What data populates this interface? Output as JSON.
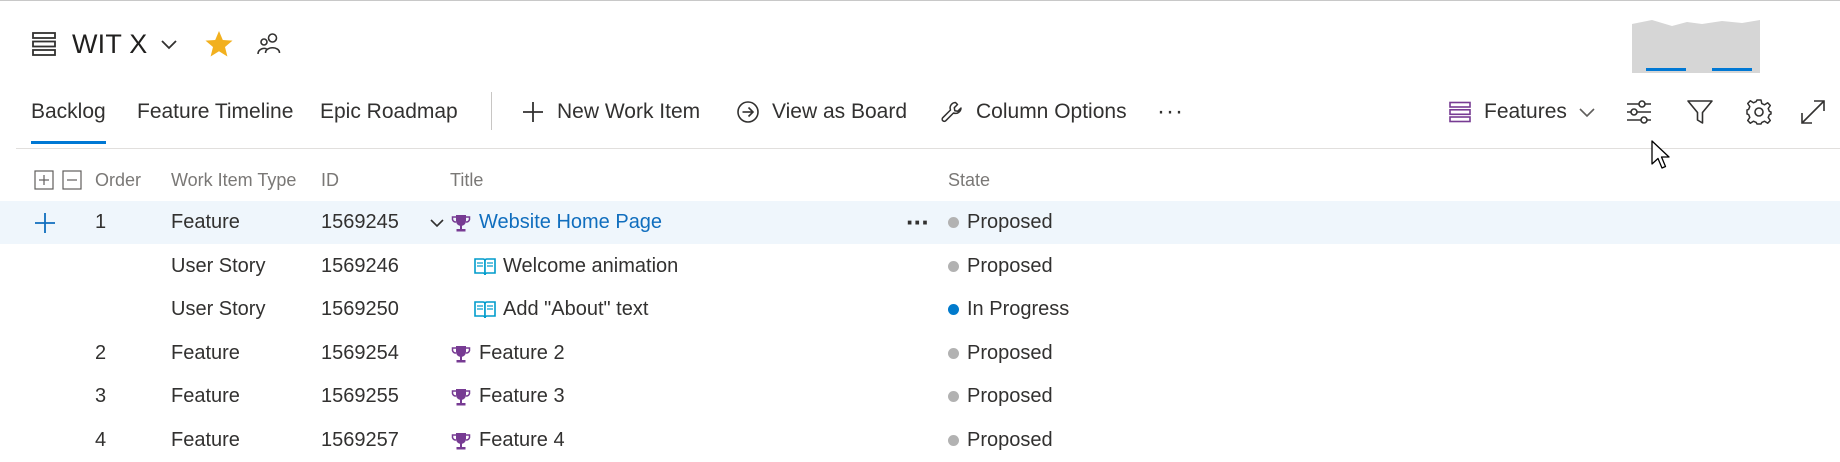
{
  "header": {
    "title": "WIT X",
    "star_color": "#f2b01e",
    "icons": [
      "backlog-icon",
      "chevron-down-icon",
      "star-icon",
      "people-icon"
    ]
  },
  "toolbar": {
    "tabs": [
      {
        "label": "Backlog",
        "active": true
      },
      {
        "label": "Feature Timeline",
        "active": false
      },
      {
        "label": "Epic Roadmap",
        "active": false
      }
    ],
    "actions": [
      {
        "label": "New Work Item",
        "icon": "plus-icon"
      },
      {
        "label": "View as Board",
        "icon": "arrow-circle-icon"
      },
      {
        "label": "Column Options",
        "icon": "wrench-icon"
      }
    ],
    "more_label": "···",
    "level_selector": "Features",
    "right_icons": [
      "settings-sliders-icon",
      "filter-icon",
      "gear-icon",
      "expand-icon"
    ]
  },
  "table": {
    "columns": [
      "Order",
      "Work Item Type",
      "ID",
      "Title",
      "State"
    ],
    "rows": [
      {
        "order": "1",
        "type": "Feature",
        "id": "1569245",
        "title": "Website Home Page",
        "state": "Proposed",
        "level": 0,
        "icon": "trophy-icon",
        "selected": true
      },
      {
        "order": "",
        "type": "User Story",
        "id": "1569246",
        "title": "Welcome animation",
        "state": "Proposed",
        "level": 1,
        "icon": "book-icon",
        "selected": false
      },
      {
        "order": "",
        "type": "User Story",
        "id": "1569250",
        "title": "Add \"About\" text",
        "state": "In Progress",
        "level": 1,
        "icon": "book-icon",
        "selected": false
      },
      {
        "order": "2",
        "type": "Feature",
        "id": "1569254",
        "title": "Feature 2",
        "state": "Proposed",
        "level": 0,
        "icon": "trophy-icon",
        "selected": false
      },
      {
        "order": "3",
        "type": "Feature",
        "id": "1569255",
        "title": "Feature 3",
        "state": "Proposed",
        "level": 0,
        "icon": "trophy-icon",
        "selected": false
      },
      {
        "order": "4",
        "type": "Feature",
        "id": "1569257",
        "title": "Feature 4",
        "state": "Proposed",
        "level": 0,
        "icon": "trophy-icon",
        "selected": false
      }
    ]
  },
  "colors": {
    "accent": "#0078d4",
    "feature_purple": "#773b93",
    "story_blue": "#009ccc",
    "proposed_gray": "#b2b2b2",
    "in_progress_blue": "#007acc"
  }
}
